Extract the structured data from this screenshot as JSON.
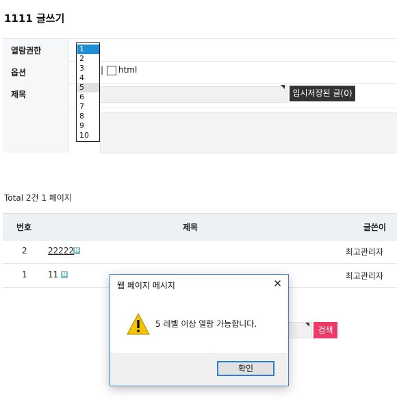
{
  "page": {
    "title": "1111 글쓰기"
  },
  "form": {
    "rows": [
      {
        "label": "열람권한"
      },
      {
        "label": "옵션"
      },
      {
        "label": "제목"
      }
    ],
    "option_pipe": "|",
    "html_label": "html",
    "draft_button": "임시저장된 글(0)"
  },
  "level_listbox": {
    "options": [
      "1",
      "2",
      "3",
      "4",
      "5",
      "6",
      "7",
      "8",
      "9",
      "10"
    ],
    "selected": "1",
    "hovered": "5"
  },
  "listing": {
    "total": "Total 2건 1 페이지",
    "columns": {
      "num": "번호",
      "title": "제목",
      "author": "글쓴이"
    },
    "rows": [
      {
        "num": "2",
        "title": "22222",
        "author": "최고관리자",
        "new_badge": "N"
      },
      {
        "num": "1",
        "title": "11",
        "author": "최고관리자",
        "new_badge": "N"
      }
    ]
  },
  "search": {
    "button": "검색"
  },
  "dialog": {
    "title": "웹 페이지 메시지",
    "close": "✕",
    "message": "5 레벨 이상 열람 가능합니다.",
    "ok": "확인",
    "icon": "warning-icon"
  },
  "colors": {
    "search_button": "#ec3b6a",
    "dialog_border": "#3c7fcf",
    "listbox_selected": "#1e90d6"
  }
}
